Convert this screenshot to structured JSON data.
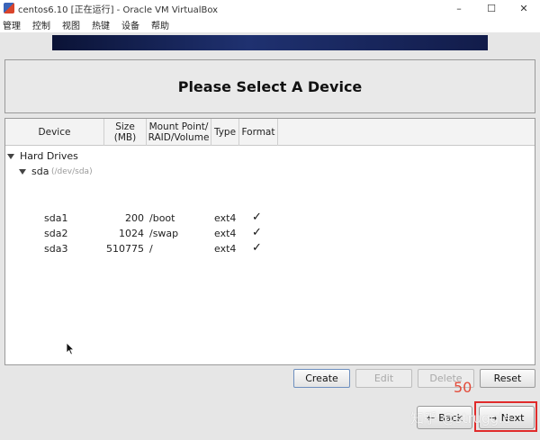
{
  "window": {
    "title": "centos6.10 [正在运行] - Oracle VM VirtualBox",
    "minimize": "–",
    "maximize": "☐",
    "close": "✕"
  },
  "menu": [
    "管理",
    "控制",
    "视图",
    "热键",
    "设备",
    "帮助"
  ],
  "installer": {
    "title": "Please Select A Device",
    "columns": {
      "device": "Device",
      "size_1": "Size",
      "size_2": "(MB)",
      "mount_1": "Mount Point/",
      "mount_2": "RAID/Volume",
      "type": "Type",
      "format": "Format"
    },
    "group": "Hard Drives",
    "disk": {
      "name": "sda",
      "path": "(/dev/sda)"
    },
    "partitions": [
      {
        "name": "sda1",
        "size": "200",
        "mount": "/boot",
        "type": "ext4",
        "format": "✓"
      },
      {
        "name": "sda2",
        "size": "1024",
        "mount": "/swap",
        "type": "ext4",
        "format": "✓"
      },
      {
        "name": "sda3",
        "size": "510775",
        "mount": "/",
        "type": "ext4",
        "format": "✓"
      }
    ],
    "buttons": {
      "create": "Create",
      "edit": "Edit",
      "delete": "Delete",
      "reset": "Reset",
      "back": "Back",
      "next": "Next"
    }
  },
  "annotation": {
    "step": "50",
    "watermark": "知乎 @struggle"
  },
  "colors": {
    "banner": "#1f3170",
    "highlight": "#e02b2b",
    "annotation": "#e34b3a"
  }
}
